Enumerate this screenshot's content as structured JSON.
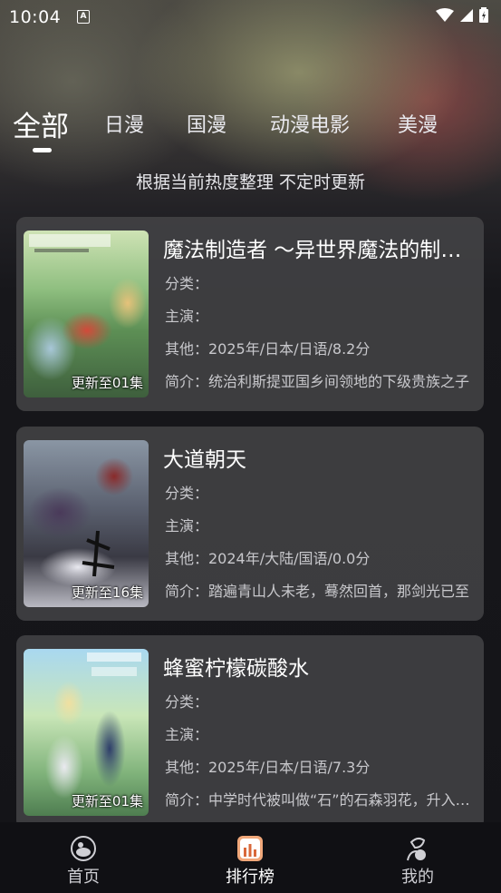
{
  "status_bar": {
    "time": "10:04",
    "notification_icon": "A"
  },
  "tabs": [
    {
      "label": "全部",
      "active": true
    },
    {
      "label": "日漫"
    },
    {
      "label": "国漫"
    },
    {
      "label": "动漫电影"
    },
    {
      "label": "美漫"
    }
  ],
  "subtitle": "根据当前热度整理 不定时更新",
  "items": [
    {
      "title": "魔法制造者 ～异世界魔法的制作方法～",
      "episode": "更新至01集",
      "category": "分类：",
      "cast": "主演：",
      "other": "其他：2025年/日本/日语/8.2分",
      "intro": "简介：统治利斯提亚国乡间领地的下级贵族之子"
    },
    {
      "title": "大道朝天",
      "episode": "更新至16集",
      "category": "分类：",
      "cast": "主演：",
      "other": "其他：2024年/大陆/国语/0.0分",
      "intro": "简介：踏遍青山人未老，蓦然回首，那剑光已至"
    },
    {
      "title": "蜂蜜柠檬碳酸水",
      "episode": "更新至01集",
      "category": "分类：",
      "cast": "主演：",
      "other": "其他：2025年/日本/日语/7.3分",
      "intro": "简介：中学时代被叫做“石”的石森羽花，升入高中"
    }
  ],
  "bottom_nav": [
    {
      "label": "首页",
      "icon": "home-icon"
    },
    {
      "label": "排行榜",
      "icon": "ranking-icon",
      "active": true
    },
    {
      "label": "我的",
      "icon": "profile-icon"
    }
  ],
  "colors": {
    "accent": "#f0a77a",
    "card_bg": "#464548",
    "nav_bg": "#101014"
  }
}
